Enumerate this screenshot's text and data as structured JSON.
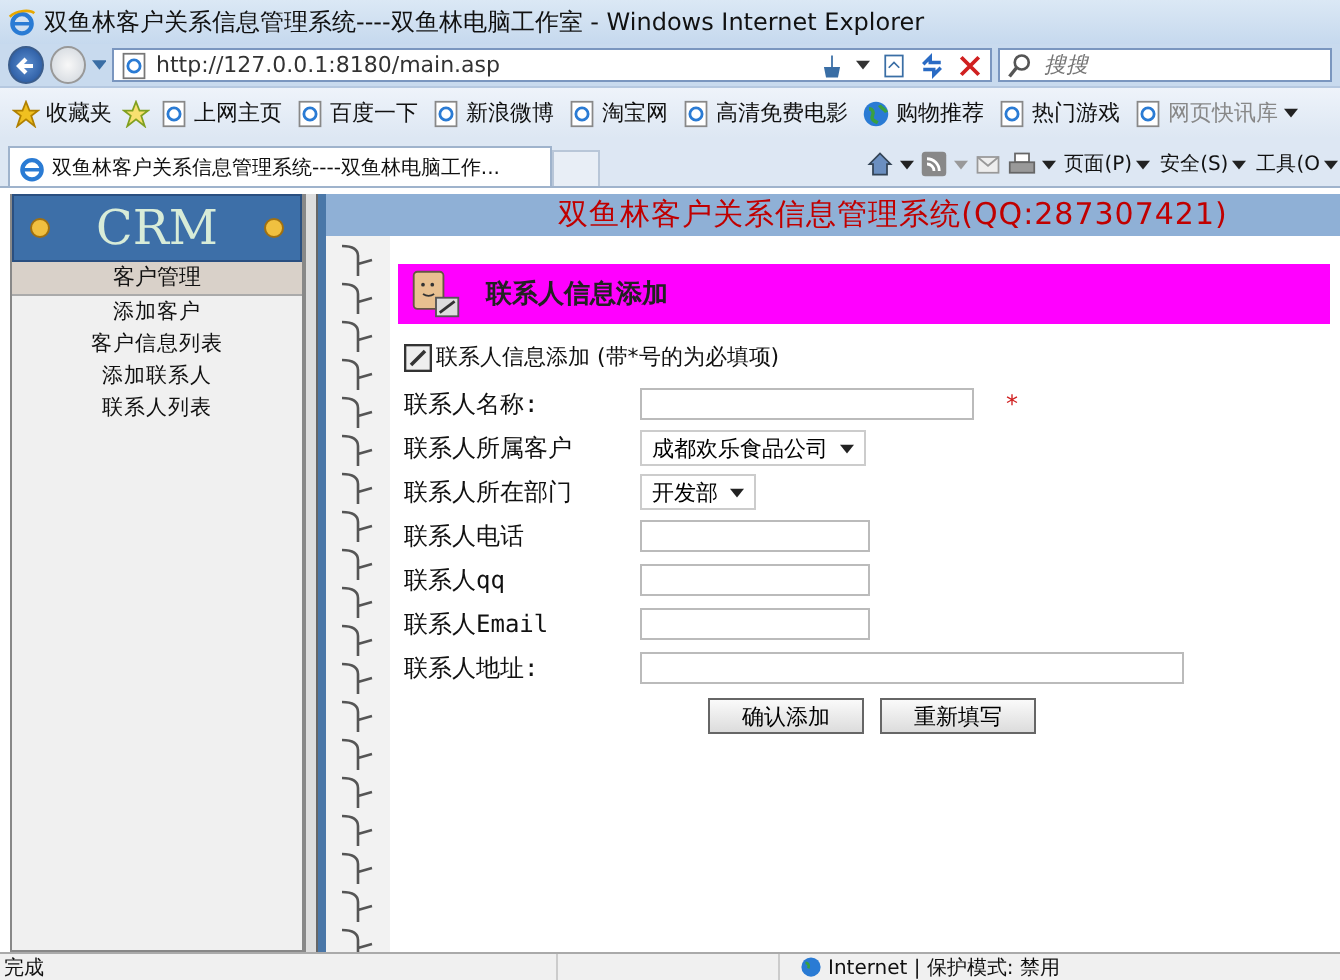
{
  "browser": {
    "title": "双鱼林客户关系信息管理系统----双鱼林电脑工作室 - Windows Internet Explorer",
    "address": "http://127.0.0.1:8180/main.asp",
    "search_placeholder": "搜搜",
    "favorites_label": "收藏夹",
    "favorites": [
      {
        "label": "上网主页",
        "kind": "page"
      },
      {
        "label": "百度一下",
        "kind": "page"
      },
      {
        "label": "新浪微博",
        "kind": "page"
      },
      {
        "label": "淘宝网",
        "kind": "page"
      },
      {
        "label": "高清免费电影",
        "kind": "page"
      },
      {
        "label": "购物推荐",
        "kind": "globe"
      },
      {
        "label": "热门游戏",
        "kind": "page"
      },
      {
        "label": "网页快讯库",
        "kind": "slice"
      }
    ],
    "tab_title": "双鱼林客户关系信息管理系统----双鱼林电脑工作...",
    "commands": [
      "页面(P)",
      "安全(S)",
      "工具(O"
    ],
    "status": {
      "text": "完成",
      "zone": "Internet | 保护模式: 禁用"
    }
  },
  "sidebar": {
    "logo": "CRM",
    "section": "客户管理",
    "items": [
      "添加客户",
      "客户信息列表",
      "添加联系人",
      "联系人列表"
    ]
  },
  "banner": "双鱼林客户关系信息管理系统(QQ:287307421)",
  "form": {
    "header": "联系人信息添加",
    "note": "联系人信息添加 (带*号的为必填项)",
    "fields": [
      {
        "label": "联系人名称:",
        "kind": "wide",
        "required": true
      },
      {
        "label": "联系人所属客户",
        "kind": "select",
        "value": "成都欢乐食品公司",
        "required": false
      },
      {
        "label": "联系人所在部门",
        "kind": "select",
        "value": "开发部",
        "required": false
      },
      {
        "label": "联系人电话",
        "kind": "text",
        "required": false
      },
      {
        "label": "联系人qq",
        "kind": "text",
        "required": false
      },
      {
        "label": "联系人Email",
        "kind": "text",
        "required": false
      },
      {
        "label": "联系人地址:",
        "kind": "long",
        "required": false
      }
    ],
    "required_mark": "*",
    "buttons": [
      "确认添加",
      "重新填写"
    ]
  }
}
